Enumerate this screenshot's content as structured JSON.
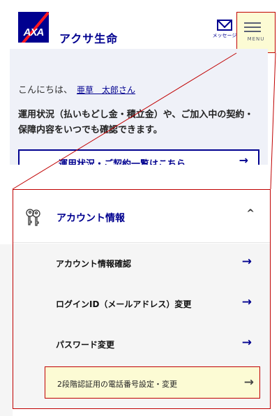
{
  "header": {
    "logo_text": "AXA",
    "brand": "アクサ生命",
    "message_label": "メッセージ",
    "menu_label": "MENU"
  },
  "intro": {
    "greeting": "こんにちは、",
    "user_name": "亜草　太郎さん",
    "description": "運用状況（払いもどし金・積立金）や、ご加入中の契約・保障内容をいつでも確認できます。",
    "link_label": "運用状況・ご契約一覧はこちら",
    "link_arrow": "→"
  },
  "menu_panel": {
    "section_title": "アカウント情報",
    "section_caret": "^",
    "items": [
      {
        "label": "アカウント情報確認",
        "arrow": "→"
      },
      {
        "label": "ログインID（メールアドレス）変更",
        "arrow": "→"
      },
      {
        "label": "パスワード変更",
        "arrow": "→"
      },
      {
        "label": "2段階認証用の電話番号設定・変更",
        "arrow": "→"
      }
    ]
  },
  "colors": {
    "brand_blue": "#00008f",
    "axa_red": "#ff1721",
    "highlight_bg": "#fcfbd4",
    "annotation_red": "#c00000",
    "card_bg": "#eff1f8"
  },
  "icons": {
    "message": "envelope-icon",
    "menu": "hamburger-icon",
    "account": "keys-icon",
    "collapse": "chevron-up-icon",
    "item_arrow": "arrow-right-icon"
  }
}
